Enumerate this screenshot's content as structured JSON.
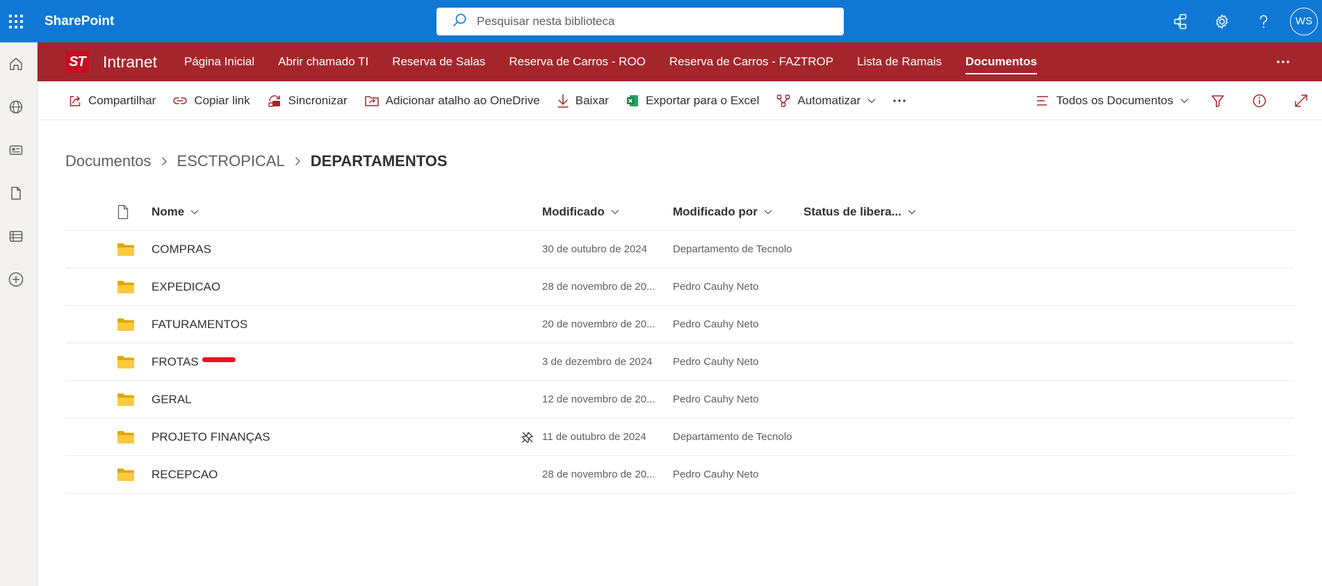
{
  "suite": {
    "brand": "SharePoint",
    "search_placeholder": "Pesquisar nesta biblioteca",
    "avatar_initials": "WS",
    "accent": "#0f78d4"
  },
  "rail": {
    "items": [
      "home-icon",
      "globe-icon",
      "news-icon",
      "document-icon",
      "list-icon",
      "add-icon"
    ]
  },
  "site": {
    "logo_text": "ST",
    "title": "Intranet",
    "color": "#a4262c",
    "nav": [
      {
        "label": "Página Inicial"
      },
      {
        "label": "Abrir chamado TI"
      },
      {
        "label": "Reserva de Salas"
      },
      {
        "label": "Reserva de Carros - ROO"
      },
      {
        "label": "Reserva de Carros - FAZTROP"
      },
      {
        "label": "Lista de Ramais"
      },
      {
        "label": "Documentos",
        "active": true
      }
    ]
  },
  "commands": {
    "share": "Compartilhar",
    "copy_link": "Copiar link",
    "sync": "Sincronizar",
    "add_shortcut": "Adicionar atalho ao OneDrive",
    "download": "Baixar",
    "export_excel": "Exportar para o Excel",
    "automate": "Automatizar",
    "view": "Todos os Documentos"
  },
  "breadcrumb": {
    "items": [
      "Documentos",
      "ESCTROPICAL"
    ],
    "current": "DEPARTAMENTOS"
  },
  "table": {
    "headers": {
      "name": "Nome",
      "modified": "Modificado",
      "modified_by": "Modificado por",
      "status": "Status de libera..."
    },
    "rows": [
      {
        "name": "COMPRAS",
        "modified": "30 de outubro de 2024",
        "by": "Departamento de Tecnolo"
      },
      {
        "name": "EXPEDICAO",
        "modified": "28 de novembro de 20...",
        "by": "Pedro Cauhy Neto"
      },
      {
        "name": "FATURAMENTOS",
        "modified": "20 de novembro de 20...",
        "by": "Pedro Cauhy Neto"
      },
      {
        "name": "FROTAS",
        "modified": "3 de dezembro de 2024",
        "by": "Pedro Cauhy Neto"
      },
      {
        "name": "GERAL",
        "modified": "12 de novembro de 20...",
        "by": "Pedro Cauhy Neto"
      },
      {
        "name": "PROJETO FINANÇAS",
        "modified": "11 de outubro de 2024",
        "by": "Departamento de Tecnolo"
      },
      {
        "name": "RECEPCAO",
        "modified": "28 de novembro de 20...",
        "by": "Pedro Cauhy Neto"
      }
    ]
  }
}
